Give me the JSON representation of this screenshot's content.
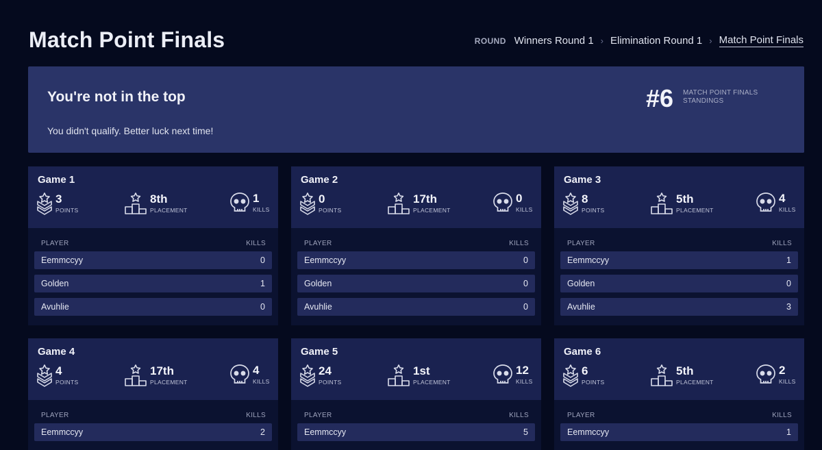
{
  "page": {
    "title": "Match Point Finals"
  },
  "breadcrumb": {
    "label": "ROUND",
    "items": [
      "Winners Round 1",
      "Elimination Round 1",
      "Match Point Finals"
    ],
    "separator": "›"
  },
  "banner": {
    "heading": "You're not in the top",
    "message": "You didn't qualify. Better luck next time!",
    "rank": "#6",
    "rank_label_line1": "MATCH POINT FINALS",
    "rank_label_line2": "STANDINGS"
  },
  "labels": {
    "points": "POINTS",
    "placement": "PLACEMENT",
    "kills": "KILLS",
    "col_player": "PLAYER",
    "col_kills": "KILLS"
  },
  "games": [
    {
      "title": "Game 1",
      "points": "3",
      "placement": "8th",
      "kills": "1",
      "players": [
        {
          "name": "Eemmccyy",
          "kills": "0"
        },
        {
          "name": "Golden",
          "kills": "1"
        },
        {
          "name": "Avuhlie",
          "kills": "0"
        }
      ]
    },
    {
      "title": "Game 2",
      "points": "0",
      "placement": "17th",
      "kills": "0",
      "players": [
        {
          "name": "Eemmccyy",
          "kills": "0"
        },
        {
          "name": "Golden",
          "kills": "0"
        },
        {
          "name": "Avuhlie",
          "kills": "0"
        }
      ]
    },
    {
      "title": "Game 3",
      "points": "8",
      "placement": "5th",
      "kills": "4",
      "players": [
        {
          "name": "Eemmccyy",
          "kills": "1"
        },
        {
          "name": "Golden",
          "kills": "0"
        },
        {
          "name": "Avuhlie",
          "kills": "3"
        }
      ]
    },
    {
      "title": "Game 4",
      "points": "4",
      "placement": "17th",
      "kills": "4",
      "players": [
        {
          "name": "Eemmccyy",
          "kills": "2"
        }
      ]
    },
    {
      "title": "Game 5",
      "points": "24",
      "placement": "1st",
      "kills": "12",
      "players": [
        {
          "name": "Eemmccyy",
          "kills": "5"
        }
      ]
    },
    {
      "title": "Game 6",
      "points": "6",
      "placement": "5th",
      "kills": "2",
      "players": [
        {
          "name": "Eemmccyy",
          "kills": "1"
        }
      ]
    }
  ],
  "colors": {
    "background": "#050a1e",
    "banner": "#2a3468",
    "card_header": "#1a2250",
    "row": "#232b5c"
  }
}
